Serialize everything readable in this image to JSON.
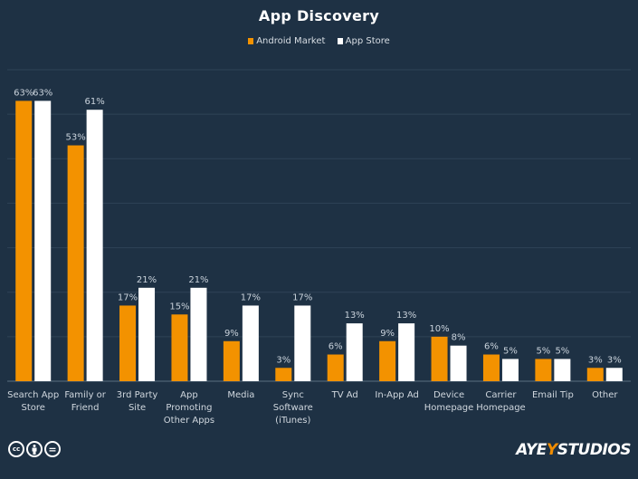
{
  "chart_data": {
    "type": "bar",
    "title": "App Discovery",
    "xlabel": "",
    "ylabel": "",
    "ylim": [
      0,
      70
    ],
    "grid": true,
    "legend_position": "top-center",
    "categories": [
      [
        "Search App",
        "Store"
      ],
      [
        "Family or",
        "Friend"
      ],
      [
        "3rd Party",
        "Site"
      ],
      [
        "App",
        "Promoting",
        "Other Apps"
      ],
      [
        "Media"
      ],
      [
        "Sync",
        "Software",
        "(iTunes)"
      ],
      [
        "TV Ad"
      ],
      [
        "In-App Ad"
      ],
      [
        "Device",
        "Homepage"
      ],
      [
        "Carrier",
        "Homepage"
      ],
      [
        "Email Tip"
      ],
      [
        "Other"
      ]
    ],
    "series": [
      {
        "name": "Android Market",
        "color": "#f39200",
        "values": [
          63,
          53,
          17,
          15,
          9,
          3,
          6,
          9,
          10,
          6,
          5,
          3
        ]
      },
      {
        "name": "App Store",
        "color": "#ffffff",
        "values": [
          63,
          61,
          21,
          21,
          17,
          17,
          13,
          13,
          8,
          5,
          5,
          3
        ]
      }
    ],
    "value_suffix": "%"
  },
  "colors": {
    "background": "#1e3144",
    "gridline": "#2e4356",
    "axis": "#5b6e80"
  },
  "footer": {
    "license_icons": [
      "cc-icon",
      "by-attribution-icon",
      "no-derivatives-icon"
    ],
    "license_text": [
      "cc",
      "",
      "="
    ],
    "logo": {
      "prefix": "AYE",
      "accent": "Y",
      "suffix": "STUDIOS"
    }
  }
}
